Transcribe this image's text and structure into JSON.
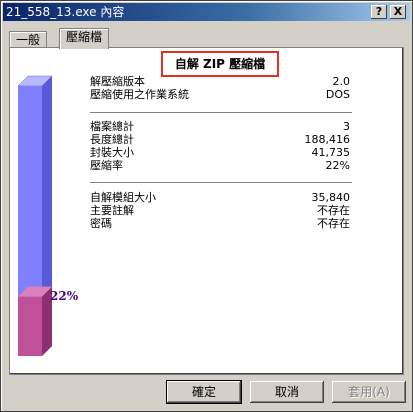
{
  "window": {
    "title": "21_558_13.exe 內容",
    "help_glyph": "?",
    "close_glyph": "X"
  },
  "tabs": [
    {
      "label": "一般"
    },
    {
      "label": "壓縮檔"
    }
  ],
  "section_title": "自解 ZIP 壓縮檔",
  "group1": [
    {
      "label": "解壓縮版本",
      "value": "2.0"
    },
    {
      "label": "壓縮使用之作業系統",
      "value": "DOS"
    }
  ],
  "group2": [
    {
      "label": "檔案總計",
      "value": "3"
    },
    {
      "label": "長度總計",
      "value": "188,416"
    },
    {
      "label": "封裝大小",
      "value": "41,735"
    },
    {
      "label": "壓縮率",
      "value": "22%"
    }
  ],
  "group3": [
    {
      "label": "自解模組大小",
      "value": "35,840"
    },
    {
      "label": "主要註解",
      "value": "不存在"
    },
    {
      "label": "密碼",
      "value": "不存在"
    }
  ],
  "gauge": {
    "fraction": 0.22,
    "label": "22%"
  },
  "buttons": {
    "ok": "確定",
    "cancel": "取消",
    "apply": "套用(A)"
  },
  "colors": {
    "title_bar": "#0a246a",
    "highlight_box": "#e5311d",
    "gauge_empty": "#8080ff",
    "gauge_fill": "#c0509a"
  }
}
